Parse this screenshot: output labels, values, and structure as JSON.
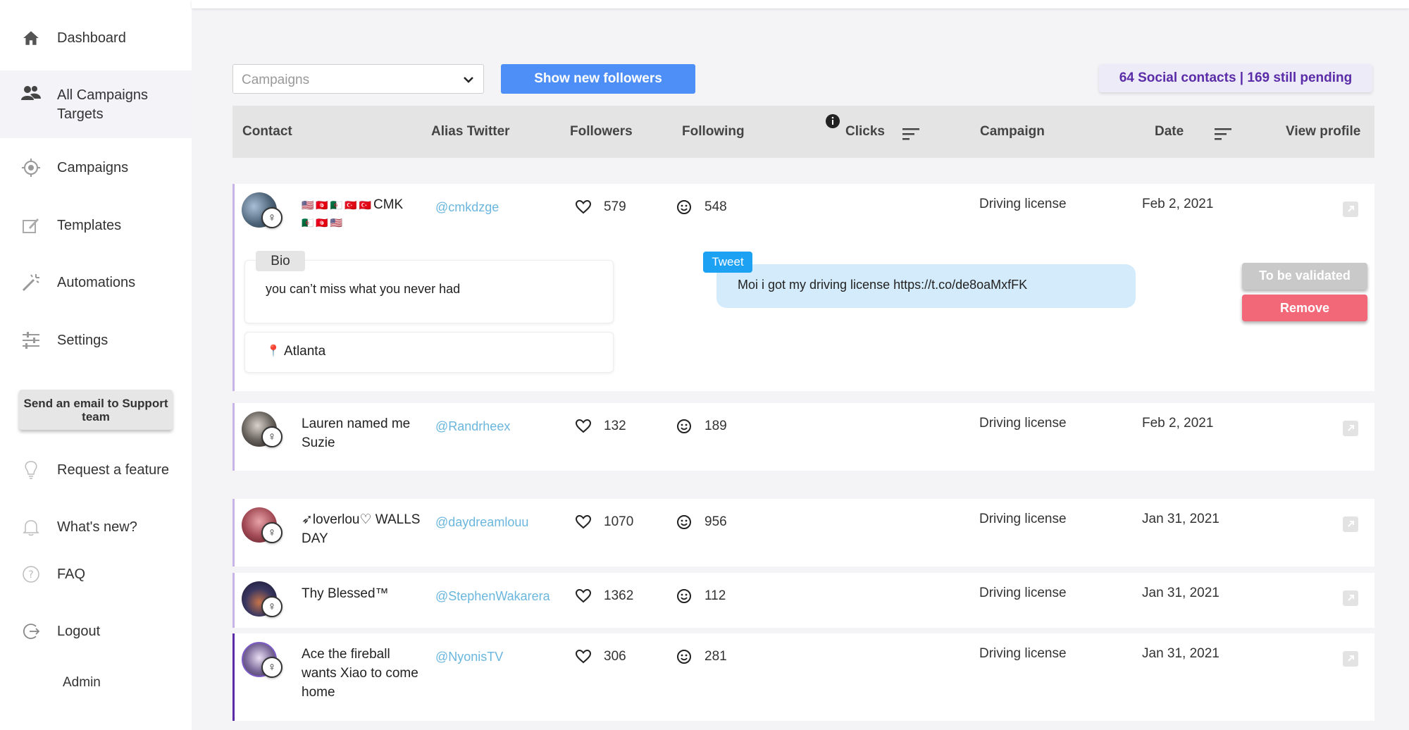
{
  "sidebar": {
    "items": [
      {
        "label": "Dashboard",
        "icon": "home-icon"
      },
      {
        "label": "All Campaigns Targets",
        "icon": "users-icon",
        "active": true
      },
      {
        "label": "Campaigns",
        "icon": "target-icon"
      },
      {
        "label": "Templates",
        "icon": "edit-icon"
      },
      {
        "label": "Automations",
        "icon": "magic-wand-icon"
      },
      {
        "label": "Settings",
        "icon": "sliders-icon"
      }
    ],
    "support_button": "Send an email to Support team",
    "bottom_items": [
      {
        "label": "Request a feature",
        "icon": "lightbulb-icon"
      },
      {
        "label": "What's new?",
        "icon": "bell-icon"
      },
      {
        "label": "FAQ",
        "icon": "question-icon"
      },
      {
        "label": "Logout",
        "icon": "logout-icon"
      }
    ],
    "user_label": "Admin"
  },
  "toolbar": {
    "campaign_placeholder": "Campaigns",
    "show_button": "Show new followers",
    "summary": "64 Social contacts | 169 still pending"
  },
  "table": {
    "columns": [
      "Contact",
      "Alias Twitter",
      "Followers",
      "Following",
      "Clicks",
      "Campaign",
      "Date",
      "View profile"
    ],
    "rows": [
      {
        "name": "CMK",
        "alias": "@cmkdzge",
        "followers": "579",
        "following": "548",
        "campaign": "Driving license",
        "date": "Feb 2, 2021",
        "expanded": true,
        "bio_label": "Bio",
        "bio": "you can’t miss what you never had",
        "location": "Atlanta",
        "tweet_label": "Tweet",
        "tweet": "Moi i got my driving license https://t.co/de8oaMxfFK",
        "validate_label": "To be validated",
        "remove_label": "Remove",
        "flags": "🇺🇸🇹🇳🇩🇿🇹🇷🇹🇷🇩🇿🇹🇳🇺🇸"
      },
      {
        "name": "Lauren named me Suzie",
        "alias": "@Randrheex",
        "followers": "132",
        "following": "189",
        "campaign": "Driving license",
        "date": "Feb 2, 2021"
      },
      {
        "name": "➶loverlou♡ WALLS DAY",
        "alias": "@daydreamlouu",
        "followers": "1070",
        "following": "956",
        "campaign": "Driving license",
        "date": "Jan 31, 2021"
      },
      {
        "name": "Thy Blessed™",
        "alias": "@StephenWakarera",
        "followers": "1362",
        "following": "112",
        "campaign": "Driving license",
        "date": "Jan 31, 2021"
      },
      {
        "name": "Ace the fireball wants Xiao to come home",
        "alias": "@NyonisTV",
        "followers": "306",
        "following": "281",
        "campaign": "Driving license",
        "date": "Jan 31, 2021"
      }
    ]
  },
  "colors": {
    "primary": "#4d8ef7",
    "summary_text": "#5b2ca8",
    "alias": "#6ab6de",
    "remove": "#f36878",
    "tweet_tag": "#1da1f2"
  }
}
